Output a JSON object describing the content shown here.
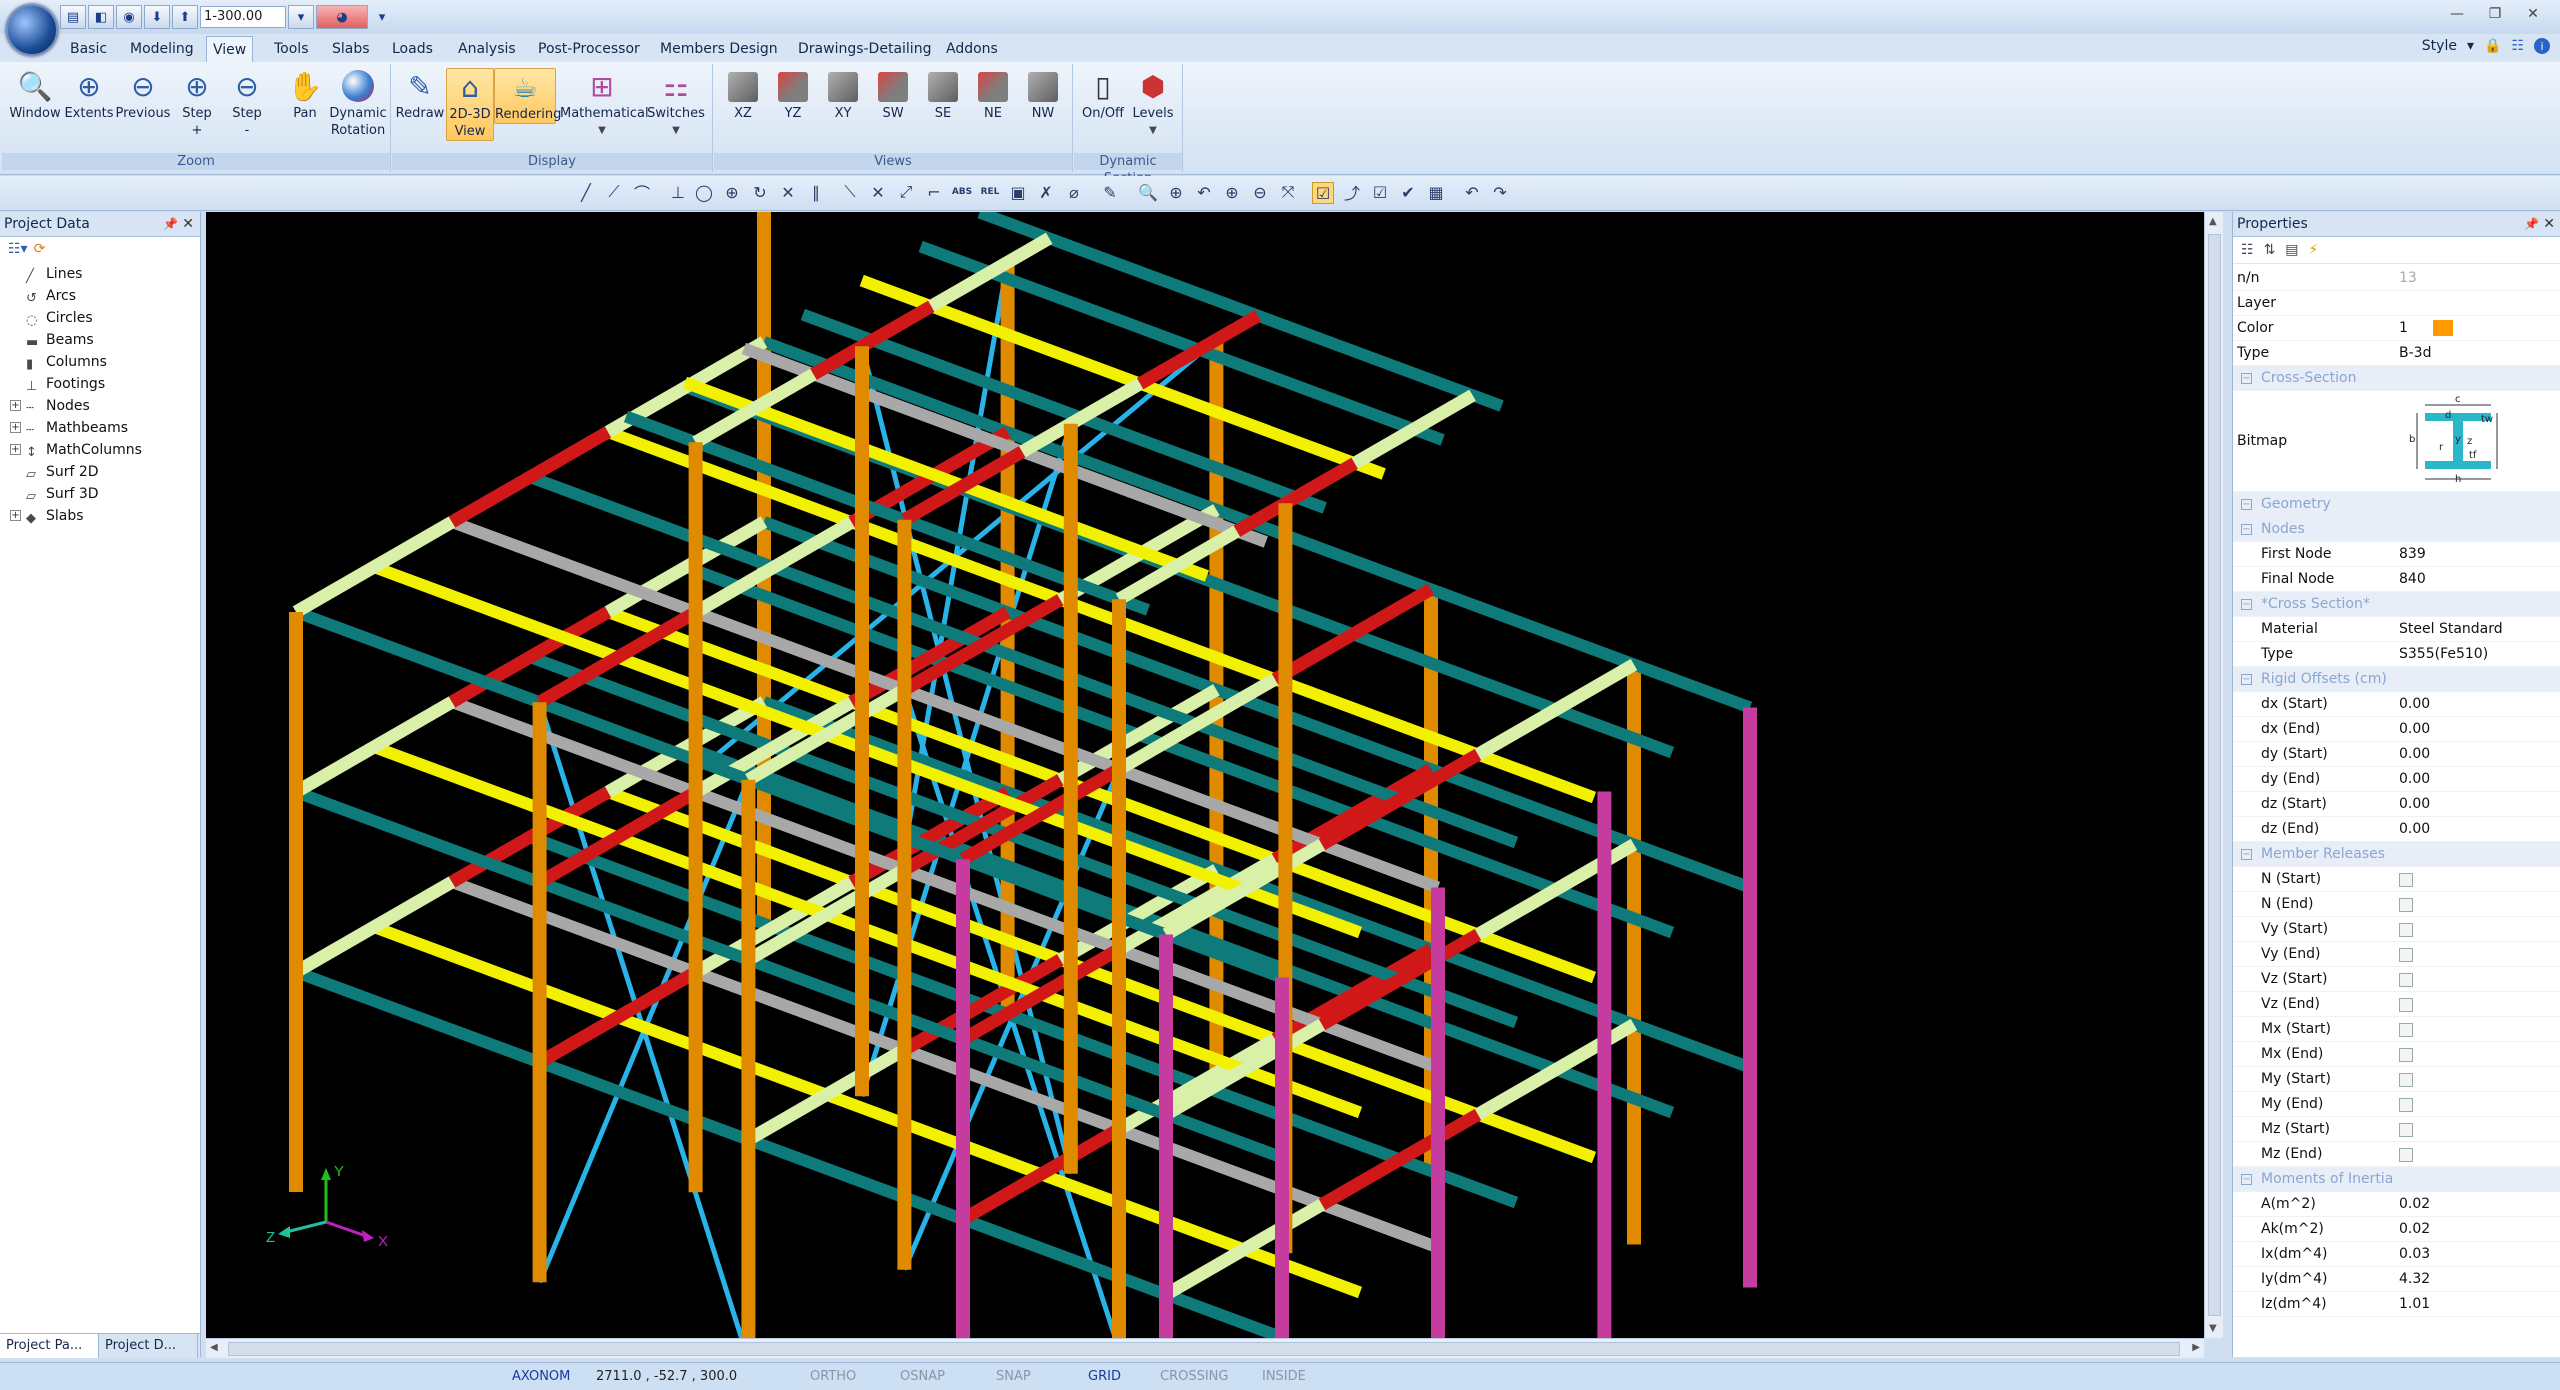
{
  "qat": {
    "scale": "1-300.00"
  },
  "ribbon": {
    "tabs": [
      "Basic",
      "Modeling",
      "View",
      "Tools",
      "Slabs",
      "Loads",
      "Analysis",
      "Post-Processor",
      "Members Design",
      "Drawings-Detailing",
      "Addons"
    ],
    "active_tab": "View",
    "style_label": "Style",
    "groups": {
      "zoom": {
        "label": "Zoom",
        "buttons": [
          "Window",
          "Extents",
          "Previous",
          "Step\n+",
          "Step\n-",
          "Pan",
          "Dynamic\nRotation"
        ]
      },
      "display": {
        "label": "Display",
        "buttons": [
          "Redraw",
          "2D-3D\nView",
          "Rendering",
          "Mathematical",
          "Switches"
        ]
      },
      "views": {
        "label": "Views",
        "buttons": [
          "XZ",
          "YZ",
          "XY",
          "SW",
          "SE",
          "NE",
          "NW"
        ]
      },
      "dynamic_section": {
        "label": "Dynamic Section",
        "buttons": [
          "On/Off",
          "Levels"
        ]
      }
    }
  },
  "project_data": {
    "title": "Project Data",
    "items": [
      {
        "label": "Lines",
        "expandable": false
      },
      {
        "label": "Arcs",
        "expandable": false
      },
      {
        "label": "Circles",
        "expandable": false
      },
      {
        "label": "Beams",
        "expandable": false
      },
      {
        "label": "Columns",
        "expandable": false
      },
      {
        "label": "Footings",
        "expandable": false
      },
      {
        "label": "Nodes",
        "expandable": true
      },
      {
        "label": "Mathbeams",
        "expandable": true
      },
      {
        "label": "MathColumns",
        "expandable": true
      },
      {
        "label": "Surf 2D",
        "expandable": false
      },
      {
        "label": "Surf 3D",
        "expandable": false
      },
      {
        "label": "Slabs",
        "expandable": true
      }
    ],
    "bottom_tabs": [
      "Project Pa...",
      "Project D..."
    ]
  },
  "properties": {
    "title": "Properties",
    "rows": [
      {
        "k": "n/n",
        "v": "13",
        "grey": true
      },
      {
        "k": "Layer",
        "v": ""
      },
      {
        "k": "Color",
        "v": "1"
      },
      {
        "k": "Type",
        "v": "B-3d"
      },
      {
        "cat": "Cross-Section"
      },
      {
        "k": "Bitmap",
        "v": "",
        "bitmap": true
      },
      {
        "cat": "Geometry"
      },
      {
        "cat": "Nodes"
      },
      {
        "k": "First Node",
        "v": "839",
        "ind": true
      },
      {
        "k": "Final Node",
        "v": "840",
        "ind": true
      },
      {
        "cat": "*Cross Section*"
      },
      {
        "k": "Material",
        "v": "Steel Standard",
        "ind": true
      },
      {
        "k": "Type",
        "v": "S355(Fe510)",
        "ind": true
      },
      {
        "cat": "Rigid Offsets (cm)"
      },
      {
        "k": "dx (Start)",
        "v": "0.00",
        "ind": true
      },
      {
        "k": "dx (End)",
        "v": "0.00",
        "ind": true
      },
      {
        "k": "dy (Start)",
        "v": "0.00",
        "ind": true
      },
      {
        "k": "dy (End)",
        "v": "0.00",
        "ind": true
      },
      {
        "k": "dz (Start)",
        "v": "0.00",
        "ind": true
      },
      {
        "k": "dz (End)",
        "v": "0.00",
        "ind": true
      },
      {
        "cat": "Member Releases"
      },
      {
        "k": "N (Start)",
        "check": true,
        "ind": true
      },
      {
        "k": "N (End)",
        "check": true,
        "ind": true
      },
      {
        "k": "Vy (Start)",
        "check": true,
        "ind": true
      },
      {
        "k": "Vy (End)",
        "check": true,
        "ind": true
      },
      {
        "k": "Vz (Start)",
        "check": true,
        "ind": true
      },
      {
        "k": "Vz (End)",
        "check": true,
        "ind": true
      },
      {
        "k": "Mx (Start)",
        "check": true,
        "ind": true
      },
      {
        "k": "Mx (End)",
        "check": true,
        "ind": true
      },
      {
        "k": "My (Start)",
        "check": true,
        "ind": true
      },
      {
        "k": "My (End)",
        "check": true,
        "ind": true
      },
      {
        "k": "Mz (Start)",
        "check": true,
        "ind": true
      },
      {
        "k": "Mz (End)",
        "check": true,
        "ind": true
      },
      {
        "cat": "Moments of Inertia"
      },
      {
        "k": "A(m^2)",
        "v": "0.02",
        "ind": true
      },
      {
        "k": "Ak(m^2)",
        "v": "0.02",
        "ind": true
      },
      {
        "k": "Ix(dm^4)",
        "v": "0.03",
        "ind": true
      },
      {
        "k": "Iy(dm^4)",
        "v": "4.32",
        "ind": true
      },
      {
        "k": "Iz(dm^4)",
        "v": "1.01",
        "ind": true
      }
    ],
    "bitmap_labels": [
      "c",
      "d",
      "tw",
      "b",
      "r",
      "y",
      "z",
      "tf",
      "h"
    ]
  },
  "axes": {
    "x": "X",
    "y": "Y",
    "z": "Z"
  },
  "status": {
    "mode": "AXONOM",
    "coords": "2711.0 , -52.7 , 300.0",
    "toggles": [
      {
        "label": "ORTHO",
        "on": false
      },
      {
        "label": "OSNAP",
        "on": false
      },
      {
        "label": "SNAP",
        "on": false
      },
      {
        "label": "GRID",
        "on": true
      },
      {
        "label": "CROSSING",
        "on": false
      },
      {
        "label": "INSIDE",
        "on": false
      }
    ]
  },
  "colors": {
    "beam_teal": "#0f7a7a",
    "beam_yellow": "#f2f200",
    "beam_red": "#d01818",
    "beam_grey": "#a8a8a8",
    "beam_pale": "#d8f0a8",
    "column_orange": "#e08a00",
    "column_magenta": "#c63c9e",
    "brace_cyan": "#28b4e8",
    "viewport_bg": "#000000"
  }
}
